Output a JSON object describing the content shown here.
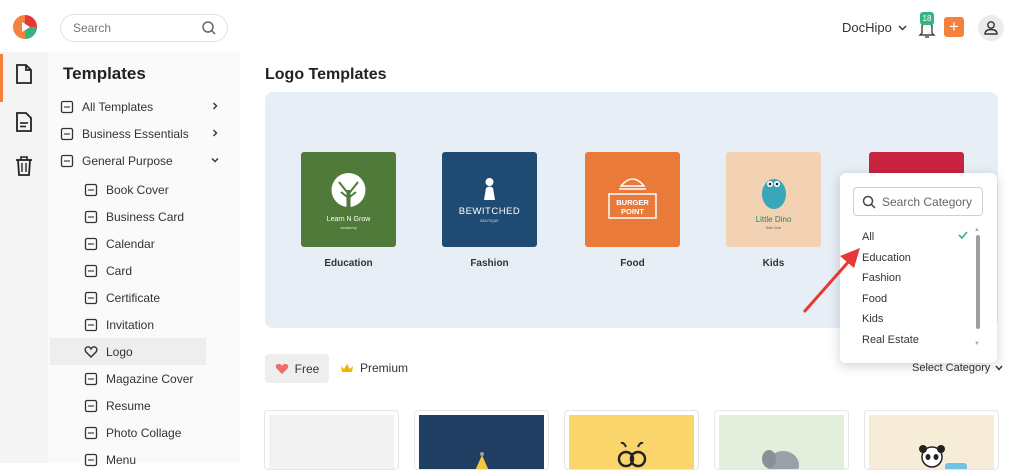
{
  "topbar": {
    "search_placeholder": "Search",
    "user_name": "DocHipo",
    "notification_count": "18",
    "add_label": "+"
  },
  "sidebar": {
    "title": "Templates",
    "items": [
      {
        "label": "All Templates",
        "icon": "all-templates-icon"
      },
      {
        "label": "Business Essentials",
        "icon": "business-icon"
      },
      {
        "label": "General Purpose",
        "icon": "general-purpose-icon"
      },
      {
        "label": "Book Cover",
        "icon": "book-cover-icon"
      },
      {
        "label": "Business Card",
        "icon": "business-card-icon"
      },
      {
        "label": "Calendar",
        "icon": "calendar-icon"
      },
      {
        "label": "Card",
        "icon": "card-icon"
      },
      {
        "label": "Certificate",
        "icon": "certificate-icon"
      },
      {
        "label": "Invitation",
        "icon": "invitation-icon"
      },
      {
        "label": "Logo",
        "icon": "heart-icon"
      },
      {
        "label": "Magazine Cover",
        "icon": "magazine-icon"
      },
      {
        "label": "Resume",
        "icon": "resume-icon"
      },
      {
        "label": "Photo Collage",
        "icon": "collage-icon"
      },
      {
        "label": "Menu",
        "icon": "menu-icon"
      }
    ]
  },
  "main": {
    "title": "Logo Templates",
    "categories": [
      {
        "label": "Education",
        "logo_text": "Learn N Grow",
        "logo_sub": "academy",
        "color": "#4f7a3a"
      },
      {
        "label": "Fashion",
        "logo_text": "BEWITCHED",
        "logo_sub": "BOUTIQUE",
        "color": "#1f4b73"
      },
      {
        "label": "Food",
        "logo_text": "BURGER",
        "logo_text2": "POINT",
        "color": "#ea7a3a"
      },
      {
        "label": "Kids",
        "logo_text": "Little Dino",
        "logo_sub": "Kids Club",
        "color": "#f3d2b3"
      }
    ],
    "filters": {
      "free": "Free",
      "premium": "Premium",
      "select_category": "Select Category"
    }
  },
  "dropdown": {
    "search_placeholder": "Search Category",
    "options": [
      "All",
      "Education",
      "Fashion",
      "Food",
      "Kids",
      "Real Estate"
    ],
    "selected": "All"
  },
  "colors": {
    "accent": "#f5813c",
    "active": "#1e88e5",
    "panel": "#e8eef6",
    "check": "#36b37e",
    "arrow": "#e53935"
  }
}
